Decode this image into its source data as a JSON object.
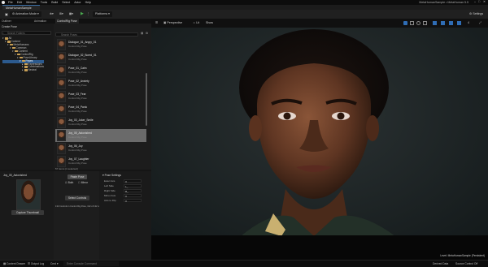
{
  "menu": [
    "File",
    "Edit",
    "Window",
    "Tools",
    "Build",
    "Select",
    "Actor",
    "Help"
  ],
  "window_title": "MetaHumanSample • MetaHuman 5.5",
  "document_tab": "MetaHumanSample",
  "toolbar": {
    "mode": "Animation Mode",
    "platforms": "Platforms",
    "settings": "Settings"
  },
  "panel_tabs": [
    "Outliner",
    "Animation",
    "ControlRig Pose"
  ],
  "outliner": {
    "create_pose": "Create Pose",
    "search_placeholder": "Search Folders",
    "tree": [
      "All",
      "Content",
      "MetaHumans",
      "Common",
      "Content",
      "ControlRig",
      "PoseLibrary",
      "Poses",
      "Expressions",
      "Combinations",
      "Neutral"
    ],
    "selected_index": 7
  },
  "assets": {
    "search_placeholder": "Search Poses",
    "items": [
      {
        "name": "Dialogue_01_Angry_01",
        "type": "Control Rig Pose"
      },
      {
        "name": "Dialogue_02_Bored_01",
        "type": "Control Rig Pose"
      },
      {
        "name": "Pose_01_Calm",
        "type": "Control Rig Pose"
      },
      {
        "name": "Pose_02_Anxiety",
        "type": "Control Rig Pose"
      },
      {
        "name": "Pose_03_Fear",
        "type": "Control Rig Pose"
      },
      {
        "name": "Pose_04_Panic",
        "type": "Control Rig Pose"
      },
      {
        "name": "Joy_03_Joker_Smile",
        "type": "Control Rig Pose"
      },
      {
        "name": "Joy_05_Astonished",
        "type": "Control Rig Pose"
      },
      {
        "name": "Joy_06_Joy",
        "type": "Control Rig Pose"
      },
      {
        "name": "Joy_07_Laughter",
        "type": "Control Rig Pose"
      }
    ],
    "selected_index": 7,
    "count_text": "57 items (1 selected)"
  },
  "pose_preview": {
    "name": "Joy_05_Astonished",
    "capture_button": "Capture Thumbnail"
  },
  "pose_actions": {
    "paste_pose": "Paste Pose",
    "select_controls": "Select Controls",
    "both": "Both",
    "mirror": "Mirror",
    "status": "132 Controls in Control Rig Pose, 132 of 132 used"
  },
  "pose_settings": {
    "title": "Pose Settings",
    "rows": [
      {
        "label": "Euler Axis",
        "value": "X"
      },
      {
        "label": "Left Side",
        "value": "L_"
      },
      {
        "label": "Right Side",
        "value": "R_"
      },
      {
        "label": "Mirror Axis",
        "value": "X"
      },
      {
        "label": "Axis to Flip",
        "value": "X"
      }
    ]
  },
  "viewport": {
    "perspective": "Perspective",
    "lit": "Lit",
    "show": "Show",
    "speed": "4",
    "level_label": "Level: MetaHumanSample (Persistent)"
  },
  "statusbar": {
    "content_drawer": "Content Drawer",
    "output_log": "Output Log",
    "cmd": "Cmd",
    "console_placeholder": "Enter Console Command",
    "derived_data": "Derived Data",
    "source_control": "Source Control Off"
  },
  "colors": {
    "selection": "#2c5a8e",
    "accent": "#3a6ea5"
  }
}
